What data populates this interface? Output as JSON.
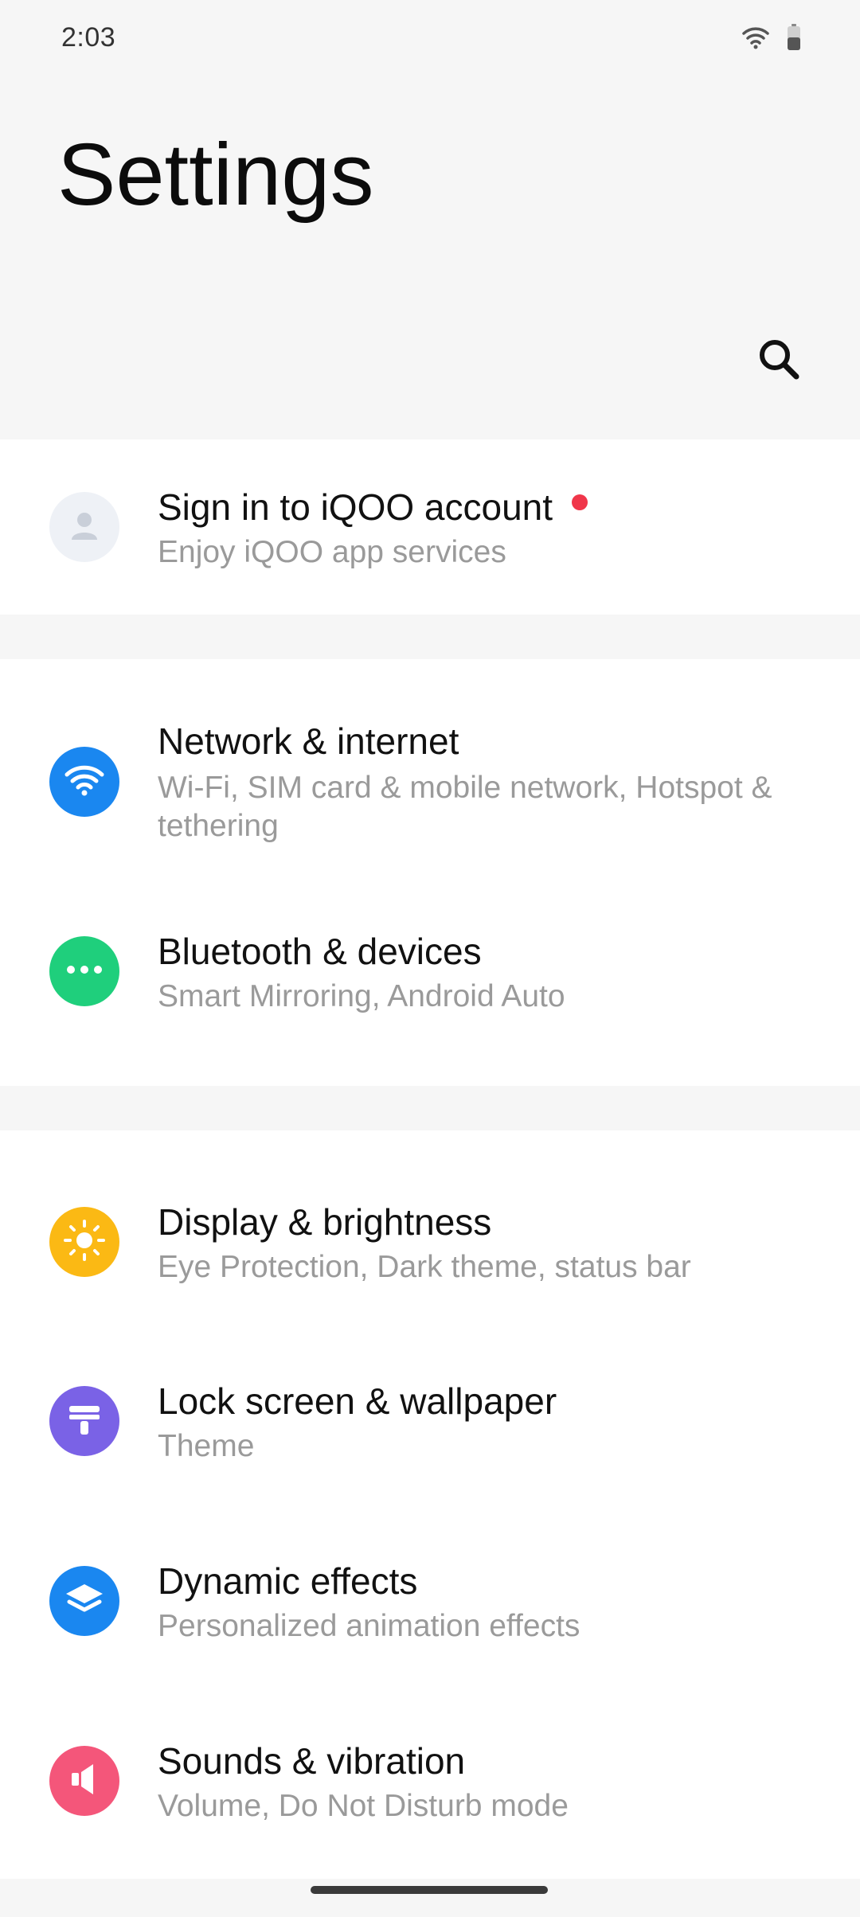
{
  "status_bar": {
    "time": "2:03",
    "icons": [
      "wifi-icon",
      "battery-icon"
    ]
  },
  "header": {
    "title": "Settings",
    "search_icon": "search-icon"
  },
  "account": {
    "title": "Sign in to iQOO account",
    "subtitle": "Enjoy iQOO app services",
    "has_badge": true,
    "icon": "avatar-icon",
    "colors": {
      "icon_bg": "#eef1f6",
      "badge": "#f0364a"
    }
  },
  "connectivity": [
    {
      "title": "Network & internet",
      "subtitle": "Wi-Fi, SIM card & mobile network, Hotspot & tethering",
      "icon": "wifi-icon",
      "color": "#1a87f0"
    },
    {
      "title": "Bluetooth & devices",
      "subtitle": "Smart Mirroring, Android Auto",
      "icon": "more-dots-icon",
      "color": "#1fcf7c"
    }
  ],
  "personalization": [
    {
      "title": "Display & brightness",
      "subtitle": "Eye Protection, Dark theme, status bar",
      "icon": "sun-icon",
      "color": "#fbb914"
    },
    {
      "title": "Lock screen & wallpaper",
      "subtitle": "Theme",
      "icon": "brush-icon",
      "color": "#7a62e6"
    },
    {
      "title": "Dynamic effects",
      "subtitle": "Personalized animation effects",
      "icon": "layers-icon",
      "color": "#1a87f0"
    },
    {
      "title": "Sounds & vibration",
      "subtitle": "Volume, Do Not Disturb mode",
      "icon": "speaker-icon",
      "color": "#f4567a"
    }
  ]
}
